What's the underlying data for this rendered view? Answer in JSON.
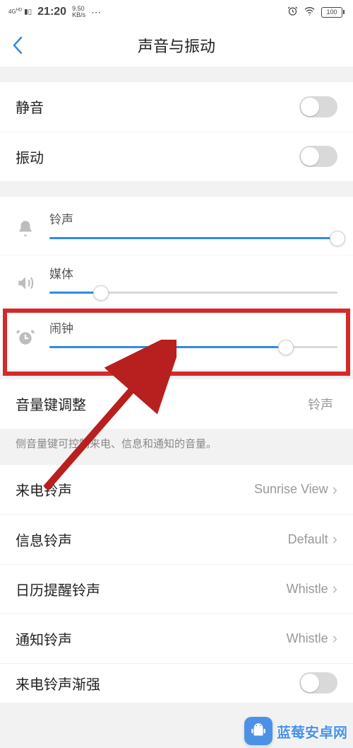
{
  "status": {
    "network": "4G HD",
    "time": "21:20",
    "speed_top": "9.50",
    "speed_unit": "KB/s",
    "battery": "100"
  },
  "title": "声音与振动",
  "toggles": {
    "silent": {
      "label": "静音",
      "on": false
    },
    "vibrate": {
      "label": "振动",
      "on": false
    }
  },
  "sliders": {
    "ringtone": {
      "label": "铃声",
      "percent": 100
    },
    "media": {
      "label": "媒体",
      "percent": 18
    },
    "alarm": {
      "label": "闹钟",
      "percent": 82
    }
  },
  "volumeKey": {
    "label": "音量键调整",
    "value": "铃声",
    "help": "侧音量键可控制来电、信息和通知的音量。"
  },
  "soundRows": {
    "incoming": {
      "label": "来电铃声",
      "value": "Sunrise View"
    },
    "message": {
      "label": "信息铃声",
      "value": "Default"
    },
    "calendar": {
      "label": "日历提醒铃声",
      "value": "Whistle"
    },
    "notify": {
      "label": "通知铃声",
      "value": "Whistle"
    }
  },
  "incomingIncrease": {
    "label": "来电铃声渐强",
    "on": false
  },
  "watermark": "蓝莓安卓网"
}
